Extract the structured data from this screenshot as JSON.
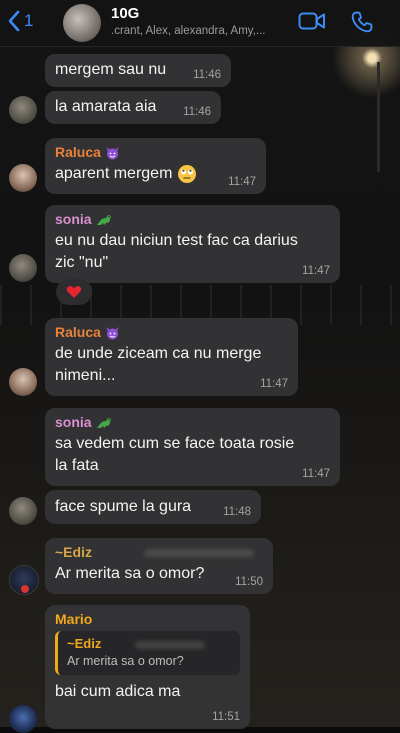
{
  "header": {
    "back_count": "1",
    "group_name": "10G",
    "members": ".crant, Alex, alexandra, Amy,..."
  },
  "colors": {
    "accent": "#3b8cf5",
    "raluca": "#e8823a",
    "sonia": "#d98fd0",
    "ediz": "#d8a74a",
    "mario": "#f0a81c"
  },
  "messages": [
    {
      "text": "mergem sau nu",
      "time": "11:46"
    },
    {
      "text": "la amarata aia",
      "time": "11:46"
    },
    {
      "sender": "Raluca",
      "sender_icon": "devil-emoji-icon",
      "text": "aparent mergem",
      "emoji": "rolling-eyes-emoji-icon",
      "time": "11:47"
    },
    {
      "sender": "sonia",
      "sender_icon": "dinosaur-emoji-icon",
      "line1": "eu nu dau niciun test fac ca darius",
      "line2": "zic \"nu\"",
      "time": "11:47",
      "reaction": "heart-reaction-icon"
    },
    {
      "sender": "Raluca",
      "sender_icon": "devil-emoji-icon",
      "line1": "de unde ziceam ca nu merge",
      "line2": "nimeni...",
      "time": "11:47"
    },
    {
      "sender": "sonia",
      "sender_icon": "dinosaur-emoji-icon",
      "line1": "sa vedem cum se face toata rosie",
      "line2": "la fata",
      "time": "11:47"
    },
    {
      "text": "face spume la gura",
      "time": "11:48"
    },
    {
      "sender": "~Ediz",
      "text": "Ar merita sa o omor?",
      "time": "11:50"
    },
    {
      "sender": "Mario",
      "quote_sender": "~Ediz",
      "quote_text": "Ar merita sa o omor?",
      "text": "bai cum adica ma",
      "time": "11:51"
    }
  ]
}
